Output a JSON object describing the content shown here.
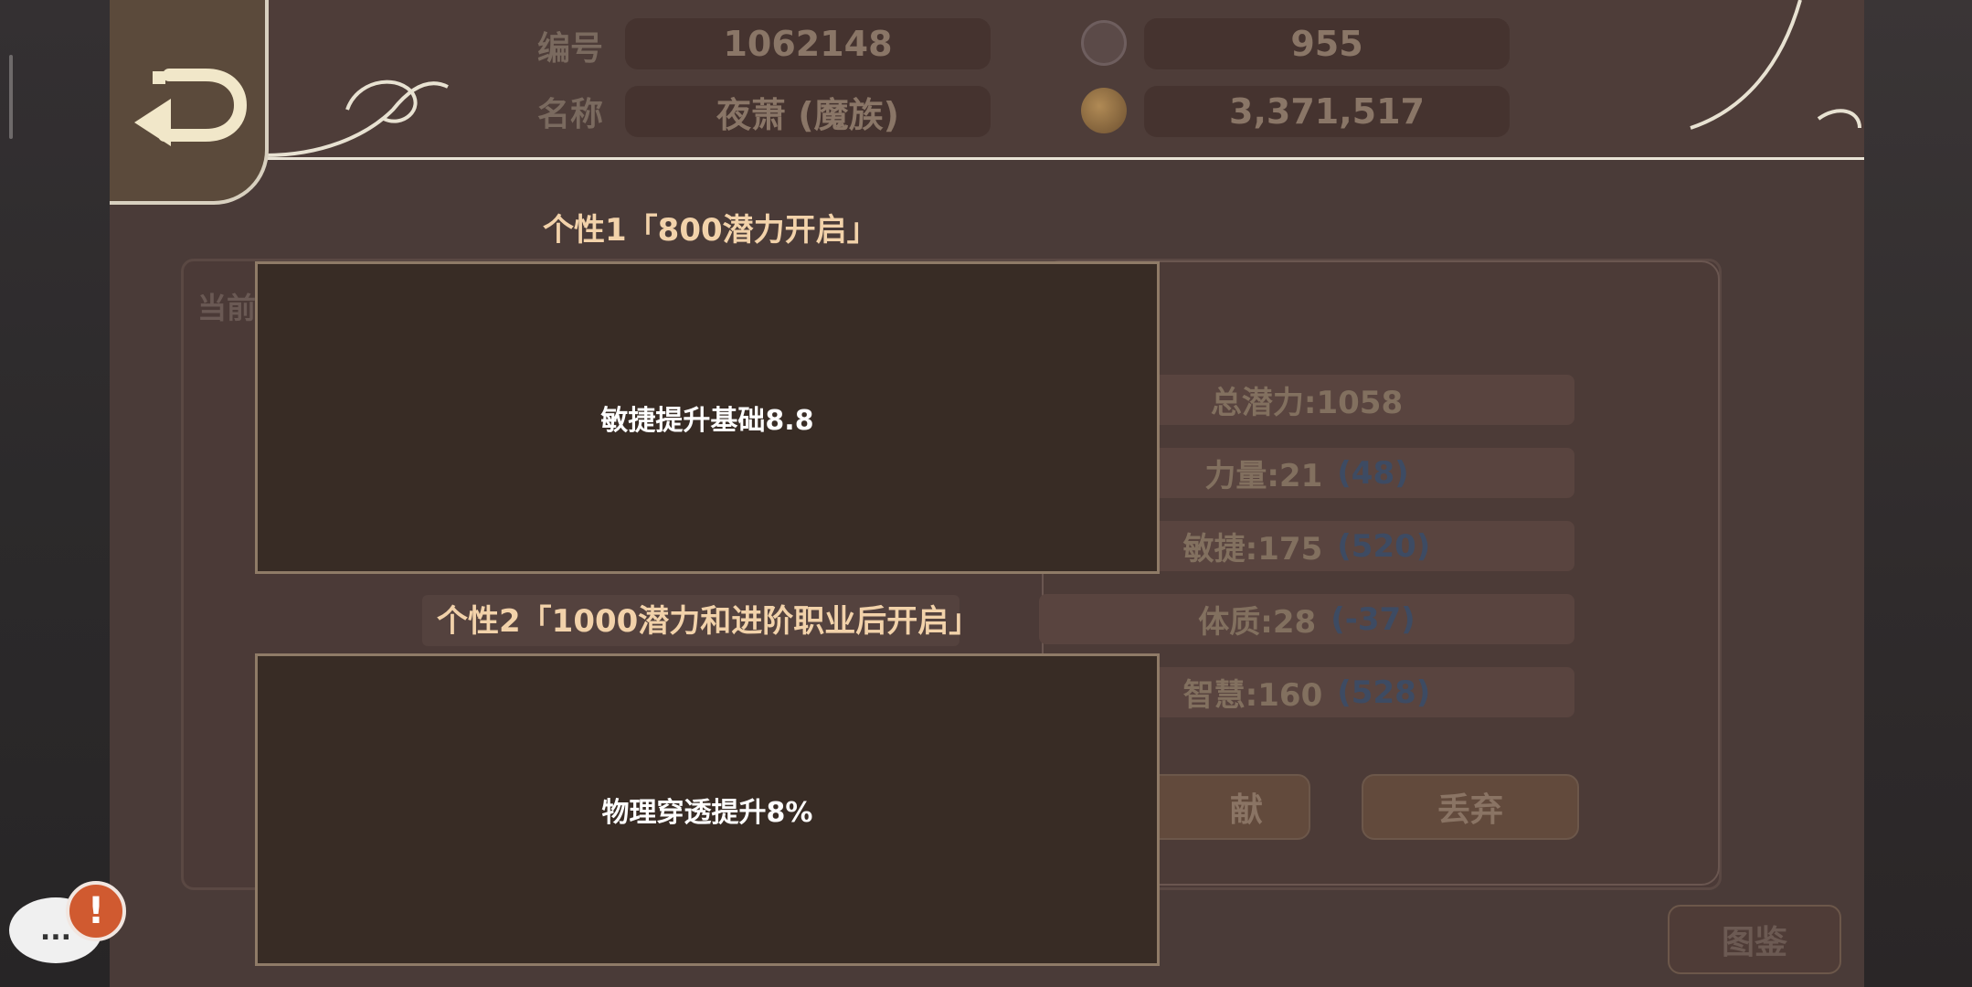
{
  "header": {
    "id_label": "编号",
    "id_value": "1062148",
    "name_label": "名称",
    "name_value": "夜萧 (魔族)",
    "resource1_icon": "gem-icon",
    "resource1_value": "955",
    "resource2_icon": "gold-coin-icon",
    "resource2_value": "3,371,517"
  },
  "background": {
    "current_label": "当前",
    "stats": [
      {
        "label": "总潜力:1058",
        "bonus": ""
      },
      {
        "label": "力量:21",
        "bonus": "(48)"
      },
      {
        "label": "敏捷:175",
        "bonus": "(520)"
      },
      {
        "label": "体质:28",
        "bonus": "(-37)"
      },
      {
        "label": "智慧:160",
        "bonus": "(528)"
      }
    ],
    "contribute_btn": "献",
    "discard_btn": "丢弃",
    "gallery_btn": "图鉴"
  },
  "traits": [
    {
      "title": "个性1「800潜力开启」",
      "desc": "敏捷提升基础8.8"
    },
    {
      "title": "个性2「1000潜力和进阶职业后开启」",
      "desc": "物理穿透提升8%"
    }
  ],
  "chat": {
    "icon": "chat-bubble-icon",
    "alert_icon": "alert-icon",
    "dots": "...",
    "alert_mark": "!"
  }
}
